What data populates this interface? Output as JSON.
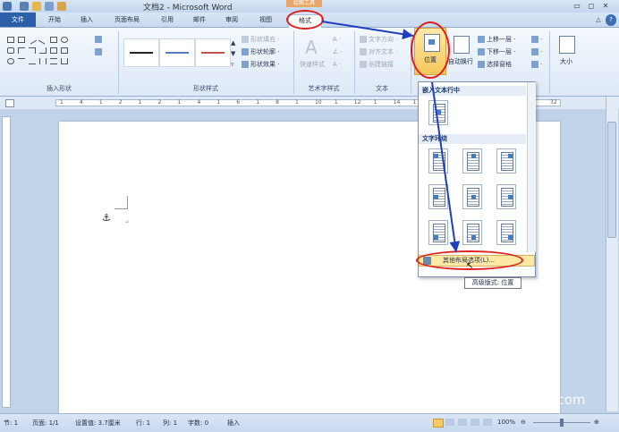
{
  "window": {
    "title": "文档2 - Microsoft Word",
    "context_tab": "绘图工具"
  },
  "tabs": [
    "文件",
    "开始",
    "插入",
    "页面布局",
    "引用",
    "邮件",
    "审阅",
    "视图",
    "格式"
  ],
  "ribbon": {
    "groups": {
      "insert_shapes": "插入形状",
      "shape_styles": "形状样式",
      "wordart_styles": "艺术字样式",
      "text": "文本"
    },
    "shape_fill": "形状填充 ·",
    "shape_outline": "形状轮廓 ·",
    "shape_effects": "形状效果 ·",
    "quick_styles": "快速样式",
    "text_direction": "文字方向 ·",
    "align_text": "对齐文本 ·",
    "create_link": "创建链接",
    "position": "位置",
    "wrap_text": "自动换行",
    "bring_forward": "上移一层 ·",
    "send_backward": "下移一层 ·",
    "selection_pane": "选择窗格",
    "size": "大小"
  },
  "dropdown": {
    "inline_heading": "嵌入文本行中",
    "wrap_heading": "文字环绕",
    "more_options": "其他布局选项(L)..."
  },
  "tooltip": "高级版式: 位置",
  "ruler_numbers": [
    "1",
    "4",
    "1",
    "2",
    "1",
    "2",
    "1",
    "4",
    "1",
    "6",
    "1",
    "8",
    "1",
    "10",
    "1",
    "12",
    "1",
    "14",
    "1",
    "16",
    "1",
    "18",
    "1",
    "20",
    "1",
    "32"
  ],
  "status": {
    "section": "节: 1",
    "page": "页面: 1/1",
    "setting": "设置值: 3.7厘米",
    "row": "行: 1",
    "col": "列: 1",
    "words": "字数: 0",
    "mode": "插入",
    "zoom": "100%"
  },
  "watermark": {
    "brand": "搜狗指南",
    "url": "zhinan.sogou.com"
  }
}
